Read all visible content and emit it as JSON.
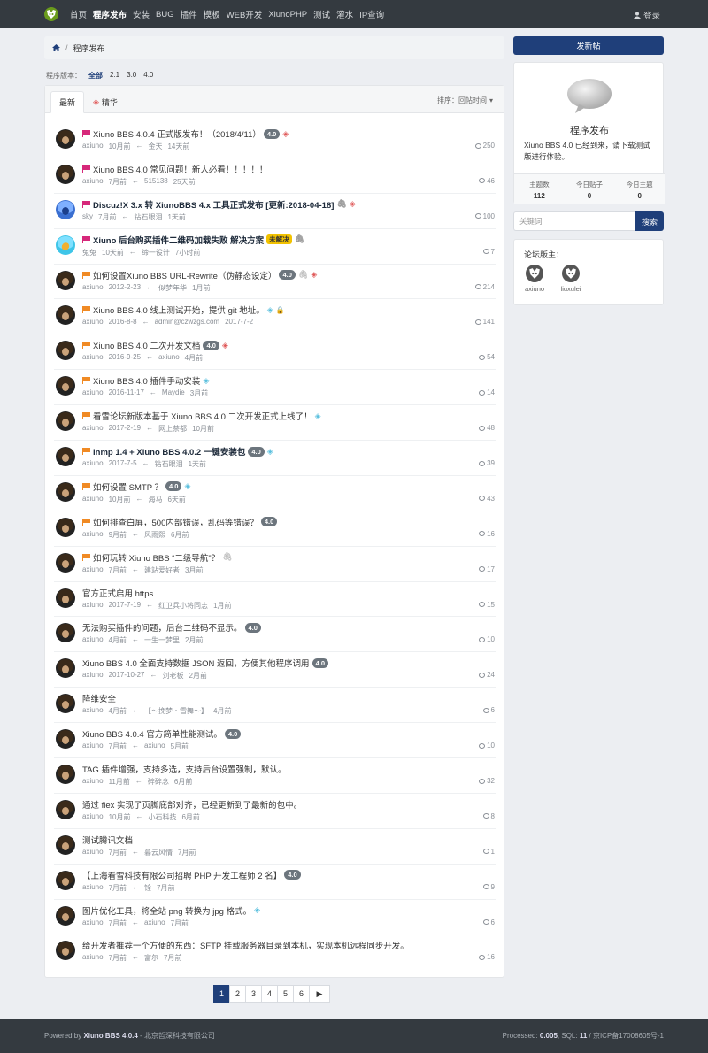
{
  "nav": {
    "items": [
      "首页",
      "程序发布",
      "安装",
      "BUG",
      "插件",
      "模板",
      "WEB开发",
      "XiunoPHP",
      "测试",
      "灌水",
      "IP查询"
    ],
    "active_index": 1,
    "login": "登录"
  },
  "breadcrumb": {
    "current": "程序发布"
  },
  "versions": {
    "label": "程序版本：",
    "options": [
      "全部",
      "2.1",
      "3.0",
      "4.0"
    ]
  },
  "tabs": {
    "latest": "最新",
    "featured": "精华",
    "sort": "排序：回帖时间"
  },
  "threads": [
    {
      "title": "Xiuno BBS 4.0.4 正式版发布！（2018/4/11）",
      "flag": "pink",
      "bold": false,
      "badge": "4.0",
      "gem": "red",
      "author": "axiuno",
      "time": "10月前",
      "last_user": "金天",
      "last_time": "14天前",
      "replies": "250",
      "avatar": "dark"
    },
    {
      "title": "Xiuno BBS 4.0 常见问题！新人必看！！！！！",
      "flag": "pink",
      "bold": false,
      "author": "axiuno",
      "time": "7月前",
      "last_user": "515138",
      "last_time": "25天前",
      "replies": "46",
      "avatar": "dark"
    },
    {
      "title": "Discuz!X 3.x 转 XiunoBBS 4.x 工具正式发布 [更新:2018-04-18]",
      "flag": "pink",
      "bold": true,
      "clip": true,
      "gem": "red",
      "author": "sky",
      "time": "7月前",
      "last_user": "钻石眼泪",
      "last_time": "1天前",
      "replies": "100",
      "avatar": "blue"
    },
    {
      "title": "Xiuno 后台购买插件二维码加载失败 解决方案",
      "flag": "pink",
      "bold": true,
      "yellow": "未解决",
      "clip": true,
      "author": "兔兔",
      "time": "10天前",
      "last_user": "缔一设计",
      "last_time": "7小时前",
      "replies": "7",
      "avatar": "cyan"
    },
    {
      "title": "如何设置Xiuno BBS URL-Rewrite（伪静态设定）",
      "flag": "orange",
      "badge": "4.0",
      "clip": true,
      "gem": "red",
      "author": "axiuno",
      "time": "2012-2-23",
      "last_user": "似梦年华",
      "last_time": "1月前",
      "replies": "214",
      "avatar": "dark"
    },
    {
      "title": "Xiuno BBS 4.0 线上测试开始，提供 git 地址。",
      "flag": "orange",
      "gem": "blue",
      "lock": true,
      "author": "axiuno",
      "time": "2016-8-8",
      "last_user": "admin@czwzgs.com",
      "last_time": "2017-7-2",
      "replies": "141",
      "avatar": "dark"
    },
    {
      "title": "Xiuno BBS 4.0 二次开发文档",
      "flag": "orange",
      "badge": "4.0",
      "gem": "red",
      "author": "axiuno",
      "time": "2016-9-25",
      "last_user": "axiuno",
      "last_time": "4月前",
      "replies": "54",
      "avatar": "dark"
    },
    {
      "title": "Xiuno BBS 4.0 插件手动安装",
      "flag": "orange",
      "gem": "blue",
      "author": "axiuno",
      "time": "2016-11-17",
      "last_user": "Maydie",
      "last_time": "3月前",
      "replies": "14",
      "avatar": "dark"
    },
    {
      "title": "看雪论坛新版本基于 Xiuno BBS 4.0 二次开发正式上线了！",
      "flag": "orange",
      "gem": "blue",
      "author": "axiuno",
      "time": "2017-2-19",
      "last_user": "网上茶都",
      "last_time": "10月前",
      "replies": "48",
      "avatar": "dark"
    },
    {
      "title": "lnmp 1.4 + Xiuno BBS 4.0.2 一键安装包",
      "flag": "orange",
      "bold": true,
      "badge": "4.0",
      "gem": "blue",
      "author": "axiuno",
      "time": "2017-7-5",
      "last_user": "钻石眼泪",
      "last_time": "1天前",
      "replies": "39",
      "avatar": "dark"
    },
    {
      "title": "如何设置 SMTP ？",
      "flag": "orange",
      "badge": "4.0",
      "gem": "blue",
      "author": "axiuno",
      "time": "10月前",
      "last_user": "海马",
      "last_time": "6天前",
      "replies": "43",
      "avatar": "dark"
    },
    {
      "title": "如何排查白屏，500内部错误，乱码等错误？",
      "flag": "orange",
      "badge": "4.0",
      "author": "axiuno",
      "time": "9月前",
      "last_user": "风雨熙",
      "last_time": "6月前",
      "replies": "16",
      "avatar": "dark"
    },
    {
      "title": "如何玩转 Xiuno BBS “二级导航”？",
      "flag": "orange",
      "clip": true,
      "author": "axiuno",
      "time": "7月前",
      "last_user": "建站爱好者",
      "last_time": "3月前",
      "replies": "17",
      "avatar": "dark"
    },
    {
      "title": "官方正式启用 https",
      "author": "axiuno",
      "time": "2017-7-19",
      "last_user": "红卫兵小将同志",
      "last_time": "1月前",
      "replies": "15",
      "avatar": "dark"
    },
    {
      "title": "无法购买插件的问题，后台二维码不显示。",
      "badge": "4.0",
      "author": "axiuno",
      "time": "4月前",
      "last_user": "一生一梦里",
      "last_time": "2月前",
      "replies": "10",
      "avatar": "dark"
    },
    {
      "title": "Xiuno BBS 4.0 全面支持数据 JSON 返回，方便其他程序调用",
      "badge": "4.0",
      "author": "axiuno",
      "time": "2017-10-27",
      "last_user": "刘老板",
      "last_time": "2月前",
      "replies": "24",
      "avatar": "dark"
    },
    {
      "title": "降维安全",
      "author": "axiuno",
      "time": "4月前",
      "last_user": "【～挽梦・雪舞～】",
      "last_time": "4月前",
      "replies": "6",
      "avatar": "dark"
    },
    {
      "title": "Xiuno BBS 4.0.4 官方简单性能测试。",
      "badge": "4.0",
      "author": "axiuno",
      "time": "7月前",
      "last_user": "axiuno",
      "last_time": "5月前",
      "replies": "10",
      "avatar": "dark"
    },
    {
      "title": "TAG 插件增强，支持多选，支持后台设置强制，默认。",
      "author": "axiuno",
      "time": "11月前",
      "last_user": "碎碎念",
      "last_time": "6月前",
      "replies": "32",
      "avatar": "dark"
    },
    {
      "title": "通过 flex 实现了页脚底部对齐，已经更新到了最新的包中。",
      "author": "axiuno",
      "time": "10月前",
      "last_user": "小石科技",
      "last_time": "6月前",
      "replies": "8",
      "avatar": "dark"
    },
    {
      "title": "测试腾讯文档",
      "author": "axiuno",
      "time": "7月前",
      "last_user": "暮云风情",
      "last_time": "7月前",
      "replies": "1",
      "avatar": "dark"
    },
    {
      "title": "【上海看雪科技有限公司招聘 PHP 开发工程师 2 名】",
      "badge": "4.0",
      "author": "axiuno",
      "time": "7月前",
      "last_user": "铨",
      "last_time": "7月前",
      "replies": "9",
      "avatar": "dark"
    },
    {
      "title": "图片优化工具，将全站 png 转换为 jpg 格式。",
      "gem": "blue",
      "author": "axiuno",
      "time": "7月前",
      "last_user": "axiuno",
      "last_time": "7月前",
      "replies": "6",
      "avatar": "dark"
    },
    {
      "title": "给开发者推荐一个方便的东西：SFTP 挂载服务器目录到本机，实现本机远程同步开发。",
      "author": "axiuno",
      "time": "7月前",
      "last_user": "富尔",
      "last_time": "7月前",
      "replies": "16",
      "avatar": "dark"
    }
  ],
  "pagination": {
    "pages": [
      "1",
      "2",
      "3",
      "4",
      "5",
      "6"
    ],
    "next": "▶"
  },
  "sidebar": {
    "new_post": "发新帖",
    "forum_name": "程序发布",
    "forum_desc": "Xiuno BBS 4.0 已经到来，请下载测试版进行体验。",
    "stats": [
      {
        "label": "主题数",
        "value": "112"
      },
      {
        "label": "今日贴子",
        "value": "0"
      },
      {
        "label": "今日主题",
        "value": "0"
      }
    ],
    "search_placeholder": "关键词",
    "search_button": "搜索",
    "mods_title": "论坛版主：",
    "mods": [
      "axiuno",
      "liuxulei"
    ]
  },
  "footer": {
    "left_prefix": "Powered by ",
    "left_brand": "Xiuno BBS 4.0.4",
    "left_suffix": " - 北京哲深科技有限公司",
    "right_prefix": "Processed: ",
    "processed": "0.005",
    "sql_label": ", SQL: ",
    "sql": "11",
    "icp": " / 京ICP备17008605号-1"
  }
}
